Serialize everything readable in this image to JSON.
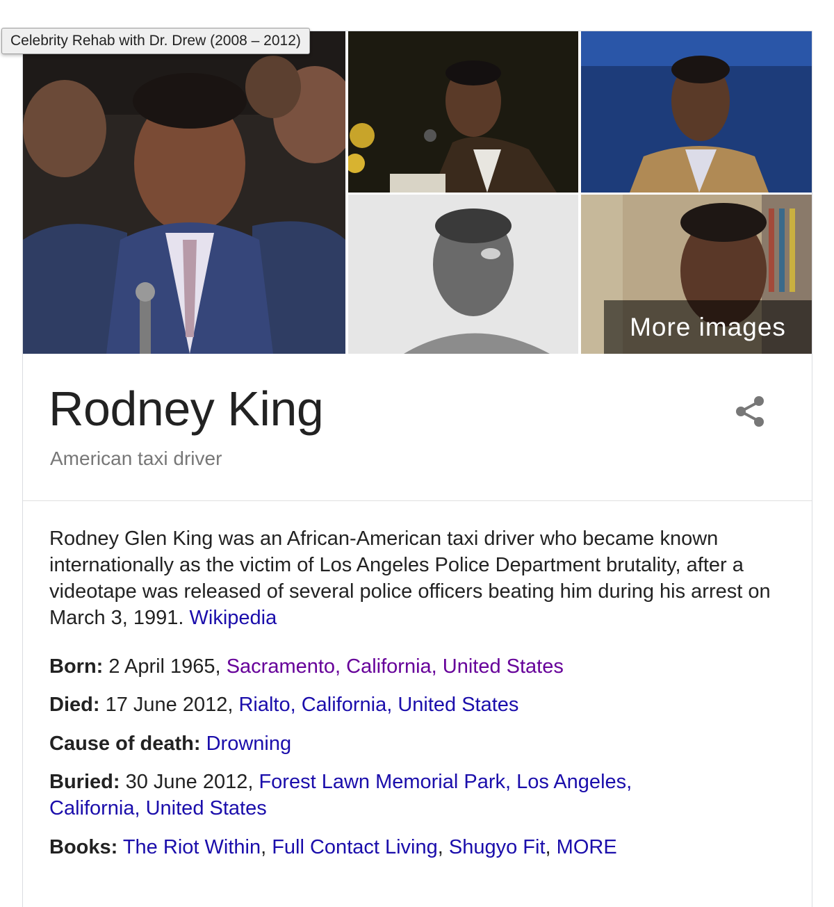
{
  "tooltip": "Celebrity Rehab with Dr. Drew (2008 – 2012)",
  "images": {
    "more_label": "More images"
  },
  "entity": {
    "title": "Rodney King",
    "subtitle": "American taxi driver"
  },
  "description": {
    "text": "Rodney Glen King was an African-American taxi driver who became known internationally as the victim of Los Angeles Police Department brutality, after a videotape was released of several police officers beating him during his arrest on March 3, 1991.",
    "source": "Wikipedia"
  },
  "facts": {
    "born": {
      "label": "Born:",
      "value": "2 April 1965,",
      "link": "Sacramento, California, United States"
    },
    "died": {
      "label": "Died:",
      "value": "17 June 2012,",
      "link": "Rialto, California, United States"
    },
    "cause": {
      "label": "Cause of death:",
      "link": "Drowning"
    },
    "buried": {
      "label": "Buried:",
      "value": "30 June 2012,",
      "link": "Forest Lawn Memorial Park, Los Angeles, California, United States"
    },
    "books": {
      "label": "Books:",
      "items": [
        "The Riot Within",
        "Full Contact Living",
        "Shugyo Fit",
        "MORE"
      ]
    }
  },
  "colors": {
    "link": "#1a0dab",
    "visited_link": "#660099",
    "text": "#222222",
    "muted": "#777777"
  }
}
